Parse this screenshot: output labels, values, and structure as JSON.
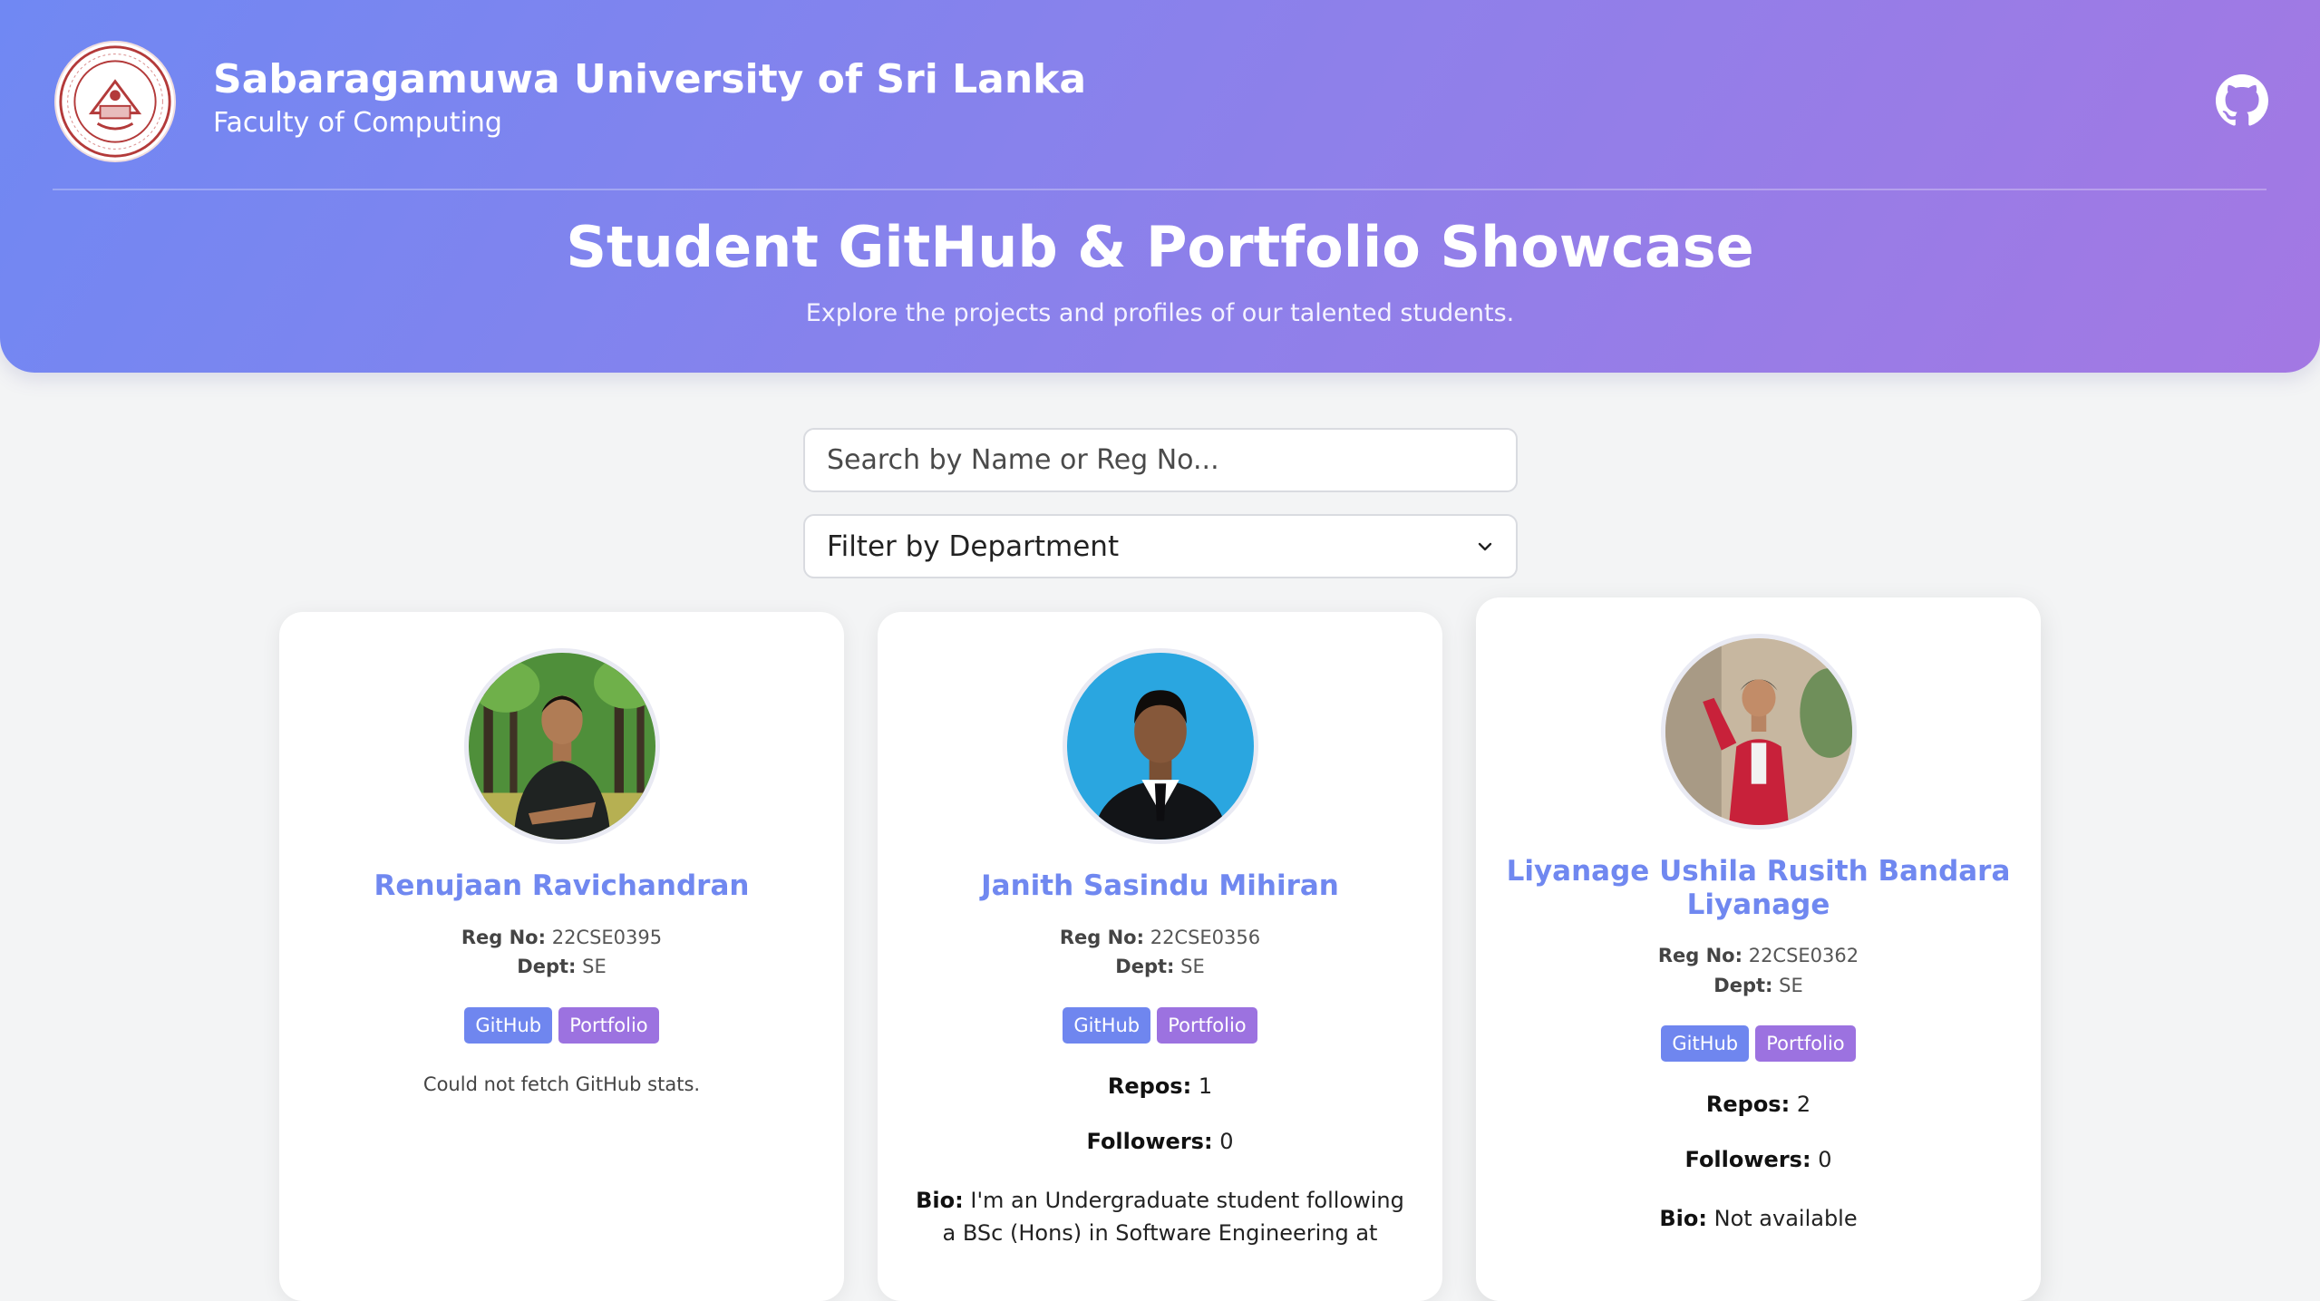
{
  "header": {
    "university_name": "Sabaragamuwa University of Sri Lanka",
    "faculty": "Faculty of Computing",
    "title": "Student GitHub & Portfolio Showcase",
    "subtitle": "Explore the projects and profiles of our talented students.",
    "logo_icon": "university-crest-icon",
    "github_icon": "github-icon"
  },
  "controls": {
    "search_placeholder": "Search by Name or Reg No...",
    "filter_label": "Filter by Department"
  },
  "labels": {
    "reg_no": "Reg No:",
    "dept": "Dept:",
    "repos": "Repos:",
    "followers": "Followers:",
    "bio": "Bio:",
    "github_button": "GitHub",
    "portfolio_button": "Portfolio"
  },
  "colors": {
    "header_gradient_start": "#7088f3",
    "header_gradient_end": "#a378e3",
    "name_color": "#7088f0",
    "github_button": "#6f86ef",
    "portfolio_button": "#9c72e0",
    "page_background": "#f3f4f5"
  },
  "students": [
    {
      "name": "Renujaan Ravichandran",
      "reg_no": "22CSE0395",
      "dept": "SE",
      "status": "Could not fetch GitHub stats."
    },
    {
      "name": "Janith Sasindu Mihiran",
      "reg_no": "22CSE0356",
      "dept": "SE",
      "repos": "1",
      "followers": "0",
      "bio": "I'm an Undergraduate student following a BSc (Hons) in Software Engineering at"
    },
    {
      "name": "Liyanage Ushila Rusith Bandara Liyanage",
      "reg_no": "22CSE0362",
      "dept": "SE",
      "repos": "2",
      "followers": "0",
      "bio": "Not available"
    }
  ]
}
